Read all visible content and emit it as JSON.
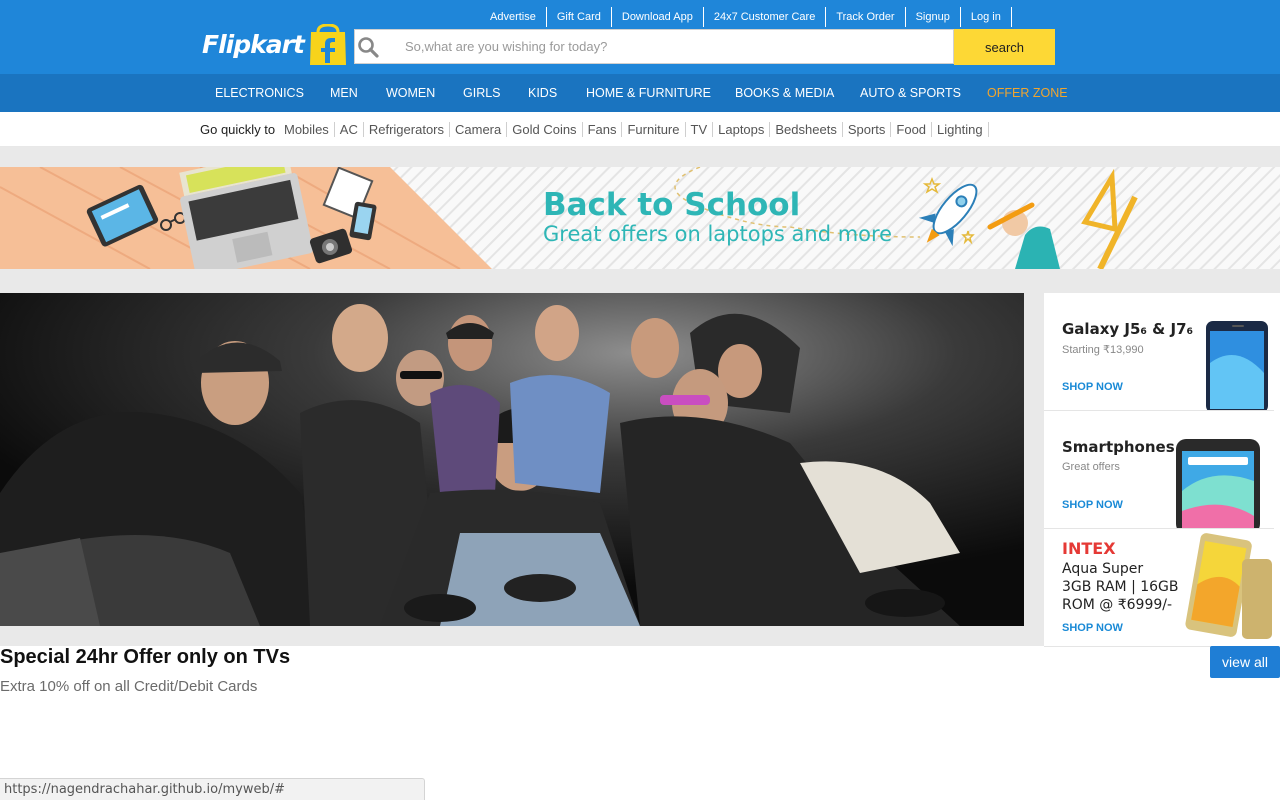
{
  "top_links": [
    "Advertise",
    "Gift Card",
    "Download App",
    "24x7 Customer Care",
    "Track Order",
    "Signup",
    "Log in"
  ],
  "brand": {
    "logo_text": "Flipkart"
  },
  "search": {
    "placeholder": "So,what are you wishing for today?",
    "button_label": "search",
    "icon": "search-icon"
  },
  "categories": [
    "ELECTRONICS",
    "MEN",
    "WOMEN",
    "GIRLS",
    "KIDS",
    "HOME & FURNITURE",
    "BOOKS & MEDIA",
    "AUTO & SPORTS",
    "OFFER ZONE"
  ],
  "quick": {
    "label": "Go quickly to",
    "links": [
      "Mobiles",
      "AC",
      "Refrigerators",
      "Camera",
      "Gold Coins",
      "Fans",
      "Furniture",
      "TV",
      "Laptops",
      "Bedsheets",
      "Sports",
      "Food",
      "Lighting"
    ]
  },
  "banner": {
    "title": "Back to School",
    "subtitle": "Great offers on laptops and more"
  },
  "promos": [
    {
      "title": "Galaxy J5₆ & J7₆",
      "subtitle": "Starting ₹13,990",
      "cta": "SHOP NOW"
    },
    {
      "title": "Smartphones",
      "subtitle": "Great offers",
      "cta": "SHOP NOW"
    },
    {
      "brand": "INTEX",
      "line1": "Aqua Super",
      "line2": "3GB RAM | 16GB",
      "line3": "ROM @ ₹6999/-",
      "cta": "SHOP NOW"
    }
  ],
  "offer": {
    "title": "Special 24hr Offer only on TVs",
    "subtitle": "Extra 10% off on all Credit/Debit Cards",
    "view_all": "view all"
  },
  "status_url": "https://nagendrachahar.github.io/myweb/#",
  "colors": {
    "header": "#1f86d9",
    "nav": "#1a74c0",
    "search_button": "#fdd835",
    "offer_zone": "#f0a52f",
    "banner_text": "#2eb6b6",
    "shop_now": "#1a8ad6",
    "view_all": "#1f7ed5"
  }
}
